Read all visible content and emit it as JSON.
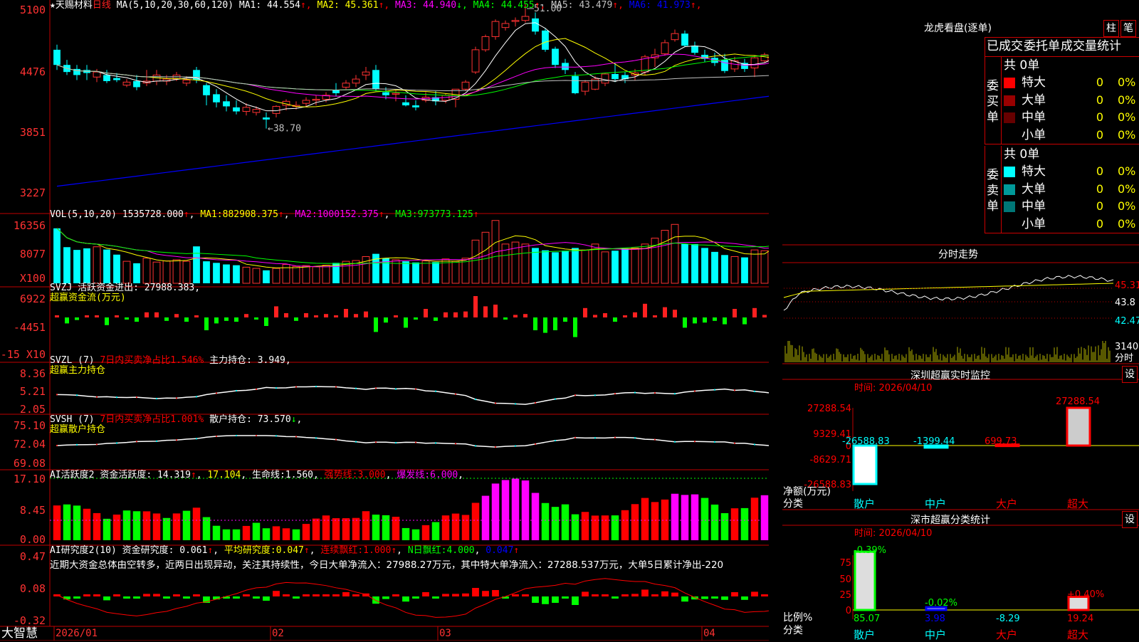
{
  "app": {
    "brand": "大智慧"
  },
  "main_chart": {
    "stock_name": "天赐材料",
    "period": "日线",
    "ma_label": "MA(5,10,20,30,60,120)",
    "ma_values": [
      {
        "name": "MA1",
        "value": "44.554",
        "arrow": "↑",
        "color": "#ffffff"
      },
      {
        "name": "MA2",
        "value": "45.361",
        "arrow": "↑",
        "color": "#ffff00"
      },
      {
        "name": "MA3",
        "value": "44.940",
        "arrow": "↓",
        "color": "#ff00ff"
      },
      {
        "name": "MA4",
        "value": "44.455",
        "arrow": "↑",
        "color": "#00ff00"
      },
      {
        "name": "MA5",
        "value": "43.479",
        "arrow": "↑",
        "color": "#c0c0c0"
      },
      {
        "name": "MA6",
        "value": "41.973",
        "arrow": "↑",
        "color": "#0000ff"
      }
    ],
    "y_ticks": [
      "5100",
      "4476",
      "3851",
      "3227"
    ],
    "high_marker": "51.00",
    "low_marker": "38.70"
  },
  "volume_panel": {
    "title": "VOL(5,10,20)",
    "value": "1535728.000",
    "ma1": "882908.375",
    "ma2": "1000152.375",
    "ma3": "973773.125",
    "y_ticks": [
      "16356",
      "8077"
    ],
    "unit": "X100"
  },
  "svzj_panel": {
    "title": "SVZJ",
    "label": "活跃资金进出:",
    "value": "27988.383",
    "subtitle": "超赢资金流(万元)",
    "y_ticks": [
      "6922",
      "-4451",
      "-15"
    ],
    "unit": "X10"
  },
  "svzl_panel": {
    "title": "SVZL (7)",
    "ratio_text": "7日内买卖净占比1.546%",
    "hold_label": "主力持仓:",
    "hold_value": "3.949",
    "subtitle": "超赢主力持仓",
    "y_ticks": [
      "8.36",
      "5.21",
      "2.05"
    ]
  },
  "svsh_panel": {
    "title": "SVSH (7)",
    "ratio_text": "7日内买卖净占比1.001%",
    "hold_label": "散户持仓:",
    "hold_value": "73.570",
    "subtitle": "超赢散户持仓",
    "y_ticks": [
      "75.10",
      "72.04",
      "69.08"
    ]
  },
  "ai_active_panel": {
    "title": "AI活跃度2",
    "label": "资金活跃度:",
    "value": "14.319",
    "value2": "17.104",
    "life_line": "生命线:1.560",
    "strong_line": "强势线:3.000",
    "burst_line": "爆发线:6.000",
    "y_ticks": [
      "17.10",
      "8.45",
      "0.00"
    ]
  },
  "ai_research_panel": {
    "title": "AI研究度2(10)",
    "label": "资金研究度:",
    "value": "0.061",
    "avg": "平均研究度:0.047",
    "consec": "连续飘红:1.000",
    "nday": "N日飘红:4.000",
    "last": "0.047",
    "commentary": "近期大资金总体由空转多，近两日出现异动，关注其持续性，今日大单净流入：27988.27万元，其中特大单净流入：27288.537万元，大单5日累计净出-220",
    "y_ticks": [
      "0.47",
      "0.08",
      "-0.32"
    ]
  },
  "x_axis": {
    "labels": [
      "2026/01",
      "02",
      "03",
      "04"
    ]
  },
  "right_panel": {
    "lhb_title": "龙虎看盘(逐单)",
    "btn_col": "柱",
    "btn_pen": "笔",
    "tabs": [
      "已成交",
      "委托单",
      "成交量统计"
    ],
    "buy_group": {
      "side_label": "委买单",
      "total": "共 0单",
      "rows": [
        {
          "name": "特大",
          "count": "0",
          "pct": "0%",
          "color": "#ff0000"
        },
        {
          "name": "大单",
          "count": "0",
          "pct": "0%",
          "color": "#990000"
        },
        {
          "name": "中单",
          "count": "0",
          "pct": "0%",
          "color": "#660000"
        },
        {
          "name": "小单",
          "count": "0",
          "pct": "0%",
          "color": ""
        }
      ]
    },
    "sell_group": {
      "side_label": "委卖单",
      "total": "共 0单",
      "rows": [
        {
          "name": "特大",
          "count": "0",
          "pct": "0%",
          "color": "#00ffff"
        },
        {
          "name": "大单",
          "count": "0",
          "pct": "0%",
          "color": "#009999"
        },
        {
          "name": "中单",
          "count": "0",
          "pct": "0%",
          "color": "#007777"
        },
        {
          "name": "小单",
          "count": "0",
          "pct": "0%",
          "color": ""
        }
      ]
    },
    "intraday": {
      "title": "分时走势",
      "y_labels": [
        "45.31",
        "43.8",
        "42.47"
      ],
      "vol_label": "31400",
      "vol_unit": "分时"
    },
    "sz_monitor": {
      "title": "深圳超赢实时监控",
      "time": "时间: 2026/04/10",
      "settings": "设",
      "y_labels": [
        "27288.54",
        "9329.41",
        "0",
        "-8629.71",
        "-26588.83"
      ],
      "y_axis_title": "净额(万元)",
      "x_axis_title": "分类",
      "categories": [
        "散户",
        "中户",
        "大户",
        "超大"
      ],
      "values": [
        -26588.83,
        -1399.44,
        699.73,
        27288.54
      ],
      "value_labels": [
        "-26588.83",
        "-1399.44",
        "699.73",
        "27288.54"
      ]
    },
    "sz_class": {
      "title": "深市超赢分类统计",
      "time": "时间: 2026/04/10",
      "settings": "设",
      "y_labels": [
        "75",
        "50",
        "25",
        "0"
      ],
      "y_axis_title": "比例%",
      "x_axis_title": "分类",
      "categories": [
        "散户",
        "中户",
        "大户",
        "超大"
      ],
      "bar_values": [
        85.07,
        3.98,
        -8.29,
        19.24
      ],
      "bar_labels": [
        "85.07",
        "3.98",
        "-8.29",
        "19.24"
      ],
      "change_labels": [
        "-0.39%",
        "-0.02%",
        "",
        "+0.40%"
      ]
    }
  },
  "chart_data": {
    "type": "candlestick",
    "title": "天赐材料 日线",
    "x_labels": [
      "2026/01",
      "02",
      "03",
      "04"
    ],
    "ylim": [
      32.27,
      51.0
    ],
    "ohlc": [
      [
        46.5,
        47.0,
        44.5,
        45.0
      ],
      [
        45.0,
        45.5,
        44.0,
        44.3
      ],
      [
        44.6,
        45.0,
        43.5,
        44.0
      ],
      [
        44.5,
        45.0,
        43.5,
        44.2
      ],
      [
        43.8,
        44.6,
        43.3,
        44.3
      ],
      [
        44.0,
        44.5,
        43.2,
        43.4
      ],
      [
        43.7,
        44.2,
        43.3,
        43.5
      ],
      [
        43.0,
        43.6,
        42.8,
        43.3
      ],
      [
        43.4,
        44.0,
        42.5,
        42.8
      ],
      [
        43.2,
        44.5,
        42.9,
        43.4
      ],
      [
        43.4,
        44.5,
        43.0,
        44.0
      ],
      [
        43.4,
        44.0,
        43.0,
        43.6
      ],
      [
        43.6,
        44.3,
        43.4,
        44.0
      ],
      [
        43.2,
        43.9,
        42.9,
        43.5
      ],
      [
        44.5,
        44.8,
        43.2,
        43.5
      ],
      [
        43.0,
        43.2,
        41.0,
        42.0
      ],
      [
        42.1,
        42.6,
        40.8,
        41.3
      ],
      [
        41.4,
        42.0,
        40.4,
        40.9
      ],
      [
        40.8,
        41.5,
        40.1,
        40.4
      ],
      [
        40.4,
        41.2,
        40.0,
        40.8
      ],
      [
        40.3,
        40.9,
        40.0,
        40.6
      ],
      [
        39.8,
        40.3,
        38.7,
        39.6
      ],
      [
        40.2,
        41.0,
        39.8,
        40.9
      ],
      [
        41.0,
        41.6,
        40.5,
        41.4
      ],
      [
        40.9,
        41.4,
        40.6,
        41.0
      ],
      [
        41.2,
        41.8,
        40.9,
        41.5
      ],
      [
        41.5,
        42.0,
        41.0,
        41.6
      ],
      [
        41.6,
        42.3,
        41.3,
        42.0
      ],
      [
        42.5,
        43.2,
        41.9,
        42.2
      ],
      [
        42.8,
        43.5,
        42.6,
        43.2
      ],
      [
        43.2,
        44.0,
        42.8,
        43.6
      ],
      [
        44.0,
        44.8,
        43.5,
        44.3
      ],
      [
        44.5,
        45.0,
        42.4,
        42.6
      ],
      [
        42.3,
        42.8,
        41.6,
        42.0
      ],
      [
        42.1,
        42.5,
        41.4,
        42.2
      ],
      [
        41.3,
        42.0,
        40.9,
        41.0
      ],
      [
        41.0,
        41.5,
        40.5,
        40.8
      ],
      [
        41.5,
        42.3,
        41.3,
        41.8
      ],
      [
        41.8,
        42.4,
        41.0,
        41.4
      ],
      [
        41.5,
        42.2,
        41.2,
        42.0
      ],
      [
        41.6,
        42.6,
        40.8,
        42.6
      ],
      [
        42.6,
        43.5,
        42.4,
        43.3
      ],
      [
        44.3,
        46.8,
        44.1,
        46.5
      ],
      [
        46.5,
        48.0,
        46.3,
        47.8
      ],
      [
        47.8,
        49.5,
        47.5,
        49.3
      ],
      [
        48.7,
        49.4,
        48.4,
        49.1
      ],
      [
        49.3,
        49.7,
        48.8,
        49.4
      ],
      [
        49.4,
        51.0,
        49.2,
        49.8
      ],
      [
        49.6,
        50.2,
        48.0,
        48.3
      ],
      [
        48.4,
        48.6,
        46.3,
        46.5
      ],
      [
        46.6,
        46.8,
        44.7,
        45.0
      ],
      [
        45.2,
        45.6,
        44.1,
        44.5
      ],
      [
        43.9,
        44.3,
        42.1,
        42.2
      ],
      [
        42.4,
        43.5,
        42.0,
        43.3
      ],
      [
        42.6,
        43.9,
        42.5,
        43.6
      ],
      [
        43.2,
        44.2,
        42.9,
        44.1
      ],
      [
        44.1,
        45.2,
        43.3,
        43.6
      ],
      [
        44.0,
        44.3,
        43.2,
        43.6
      ],
      [
        44.0,
        44.6,
        43.5,
        44.2
      ],
      [
        44.3,
        46.0,
        44.0,
        45.8
      ],
      [
        45.7,
        46.6,
        44.8,
        46.0
      ],
      [
        46.1,
        47.5,
        45.9,
        47.2
      ],
      [
        47.5,
        48.5,
        47.3,
        48.1
      ],
      [
        48.1,
        48.4,
        46.8,
        46.9
      ],
      [
        46.9,
        47.3,
        46.0,
        46.2
      ],
      [
        46.0,
        46.5,
        45.3,
        45.6
      ],
      [
        45.7,
        46.2,
        44.9,
        45.2
      ],
      [
        45.5,
        46.1,
        44.2,
        44.4
      ],
      [
        44.6,
        45.8,
        44.3,
        45.4
      ],
      [
        45.2,
        45.6,
        44.3,
        44.6
      ],
      [
        44.7,
        45.9,
        43.8,
        45.7
      ],
      [
        45.4,
        46.2,
        45.2,
        46.0
      ],
      [
        45.5,
        46.8,
        45.2,
        46.6
      ]
    ],
    "volume_series": [
      1400,
      920,
      850,
      890,
      930,
      860,
      730,
      560,
      510,
      640,
      540,
      570,
      600,
      560,
      940,
      560,
      520,
      480,
      460,
      410,
      380,
      330,
      380,
      480,
      430,
      450,
      420,
      460,
      520,
      560,
      580,
      680,
      750,
      640,
      600,
      560,
      530,
      570,
      540,
      620,
      560,
      640,
      1100,
      1300,
      1600,
      1000,
      1050,
      1000,
      900,
      840,
      790,
      830,
      900,
      850,
      1000,
      800,
      830,
      890,
      900,
      1000,
      1150,
      1350,
      1500,
      1000,
      1000,
      900,
      800,
      720,
      680,
      660,
      850,
      830,
      1550
    ],
    "ma_lines": [
      "MA1",
      "MA2",
      "MA3",
      "MA4",
      "MA5",
      "MA6"
    ]
  }
}
